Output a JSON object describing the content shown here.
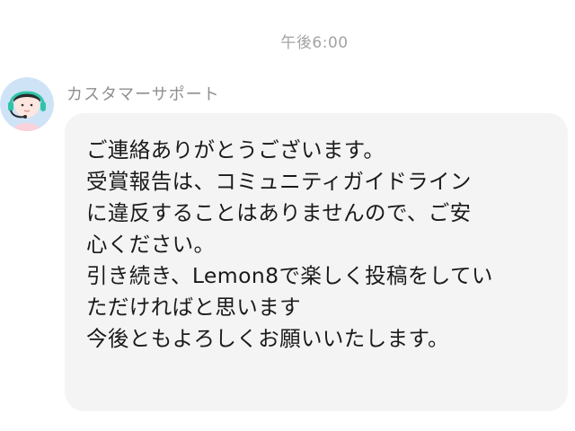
{
  "chat": {
    "timestamp": "午後6:00",
    "sender_name": "カスタマーサポート",
    "message": {
      "lines": [
        "ご連絡ありがとうございます。",
        "受賞報告は、コミュニティガイドライン",
        "に違反することはありませんので、ご安",
        "心ください。",
        "引き続き、Lemon8で楽しく投稿をしてい",
        "ただければと思います",
        "今後ともよろしくお願いいたします。"
      ]
    }
  },
  "colors": {
    "bubble_background": "#f4f4f4",
    "avatar_background": "#cfe3f7",
    "headset_accent": "#2fc4a8"
  },
  "icons": {
    "avatar": "support-agent-headset-avatar"
  }
}
